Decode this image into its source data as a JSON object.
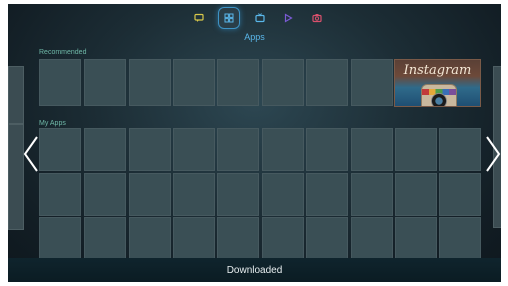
{
  "nav": {
    "items": [
      {
        "name": "chat-icon",
        "color": "#d9c94a"
      },
      {
        "name": "apps-icon",
        "color": "#5ab7ea",
        "active": true
      },
      {
        "name": "tv-icon",
        "color": "#5ab7ea"
      },
      {
        "name": "play-icon",
        "color": "#7b5bd6"
      },
      {
        "name": "camera-icon",
        "color": "#d8506c"
      }
    ],
    "active_label": "Apps"
  },
  "sections": {
    "recommended_label": "Recommended",
    "my_apps_label": "My Apps"
  },
  "featured_app": {
    "name": "Instagram"
  },
  "bottom": {
    "label": "Downloaded"
  },
  "colors": {
    "accent": "#5ab7ea",
    "section_label": "#6fb8a7",
    "tile": "#3a4f55"
  }
}
